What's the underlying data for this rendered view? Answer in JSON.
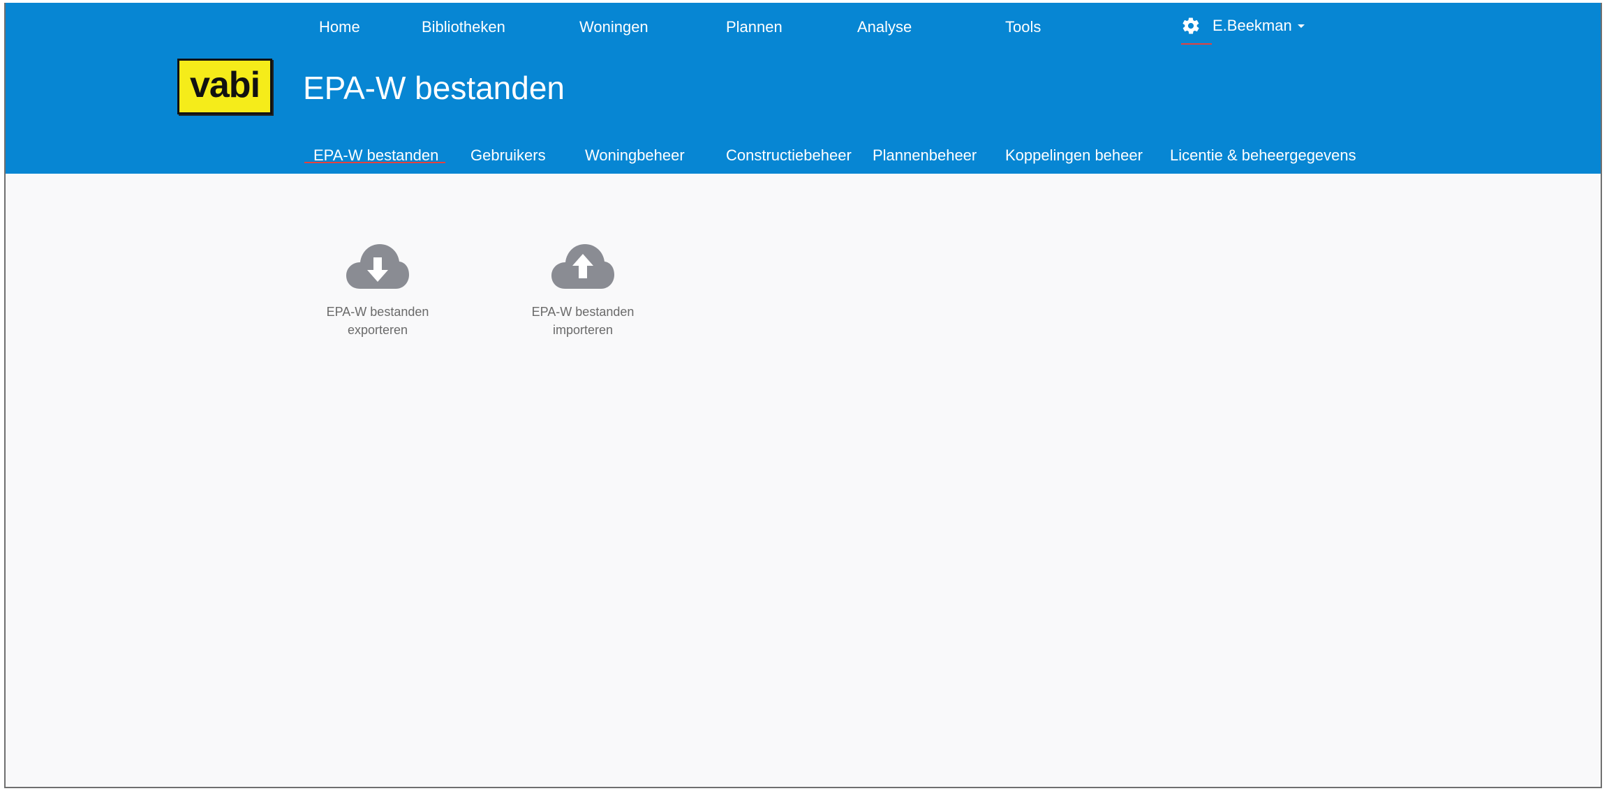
{
  "topnav": {
    "items": [
      "Home",
      "Bibliotheken",
      "Woningen",
      "Plannen",
      "Analyse",
      "Tools"
    ],
    "user": {
      "name": "E.Beekman",
      "icon": "gear-icon"
    }
  },
  "header": {
    "logo_text": "vabi",
    "title": "EPA-W bestanden"
  },
  "subnav": {
    "items": [
      "EPA-W bestanden",
      "Gebruikers",
      "Woningbeheer",
      "Constructiebeheer",
      "Plannenbeheer",
      "Koppelingen beheer",
      "Licentie & beheergegevens"
    ],
    "active": "EPA-W bestanden"
  },
  "actions": [
    {
      "line1": "EPA-W bestanden",
      "line2": "exporteren",
      "icon": "cloud-download-icon"
    },
    {
      "line1": "EPA-W bestanden",
      "line2": "importeren",
      "icon": "cloud-upload-icon"
    }
  ],
  "colors": {
    "header_bg": "#0786d3",
    "accent_underline": "#e5413d",
    "logo_bg": "#f5ec1a",
    "icon_gray": "#8a8c93",
    "content_bg": "#f9f9fa"
  }
}
